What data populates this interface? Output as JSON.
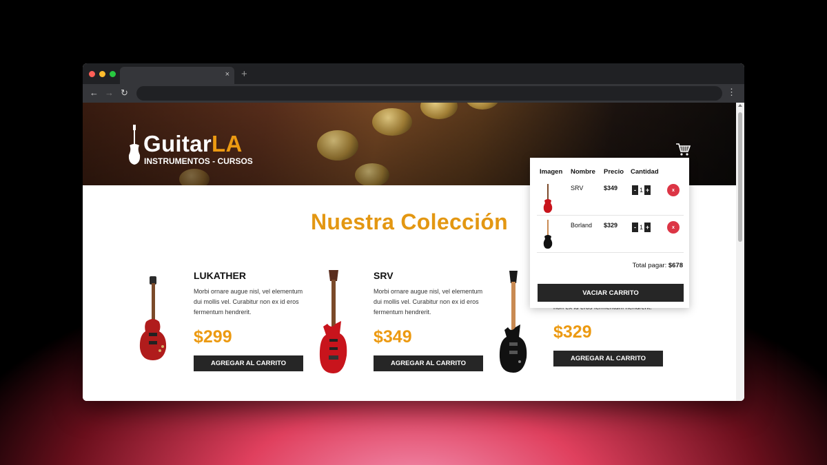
{
  "browser": {
    "tab_close_label": "×",
    "new_tab_label": "+",
    "back_label": "←",
    "forward_label": "→",
    "reload_label": "↻",
    "menu_label": "⋮",
    "traffic_colors": [
      "#ff5f57",
      "#febc2e",
      "#28c840"
    ]
  },
  "header": {
    "logo_main": "Guitar",
    "logo_accent": "LA",
    "logo_sub": "INSTRUMENTOS - CURSOS",
    "accent_color": "#ec9a12",
    "cart_icon": "shopping-cart-icon"
  },
  "section_title": "Nuestra Colección",
  "products": [
    {
      "name": "LUKATHER",
      "description": "Morbi ornare augue nisl, vel elementum dui mollis vel. Curabitur non ex id eros fermentum hendrerit.",
      "price": "$299",
      "button_label": "AGREGAR AL CARRITO",
      "body_color": "#b01c1c",
      "icon": "les-paul-guitar-icon"
    },
    {
      "name": "SRV",
      "description": "Morbi ornare augue nisl, vel elementum dui mollis vel. Curabitur non ex id eros fermentum hendrerit.",
      "price": "$349",
      "button_label": "AGREGAR AL CARRITO",
      "body_color": "#c8141c",
      "icon": "stratocaster-guitar-icon"
    },
    {
      "name": "",
      "description": "non ex id eros fermentum hendrerit.",
      "price": "$329",
      "button_label": "AGREGAR AL CARRITO",
      "body_color": "#111111",
      "icon": "black-guitar-icon"
    }
  ],
  "cart": {
    "headers": {
      "image": "Imagen",
      "name": "Nombre",
      "price": "Precio",
      "quantity": "Cantidad"
    },
    "items": [
      {
        "name": "SRV",
        "price": "$349",
        "quantity": "1",
        "minus": "-",
        "plus": "+",
        "remove": "x",
        "body_color": "#c8141c"
      },
      {
        "name": "Borland",
        "price": "$329",
        "quantity": "1",
        "minus": "-",
        "plus": "+",
        "remove": "x",
        "body_color": "#111111"
      }
    ],
    "total_label": "Total pagar:",
    "total_value": "$678",
    "empty_button": "VACIAR CARRITO",
    "remove_color": "#dc3545"
  }
}
